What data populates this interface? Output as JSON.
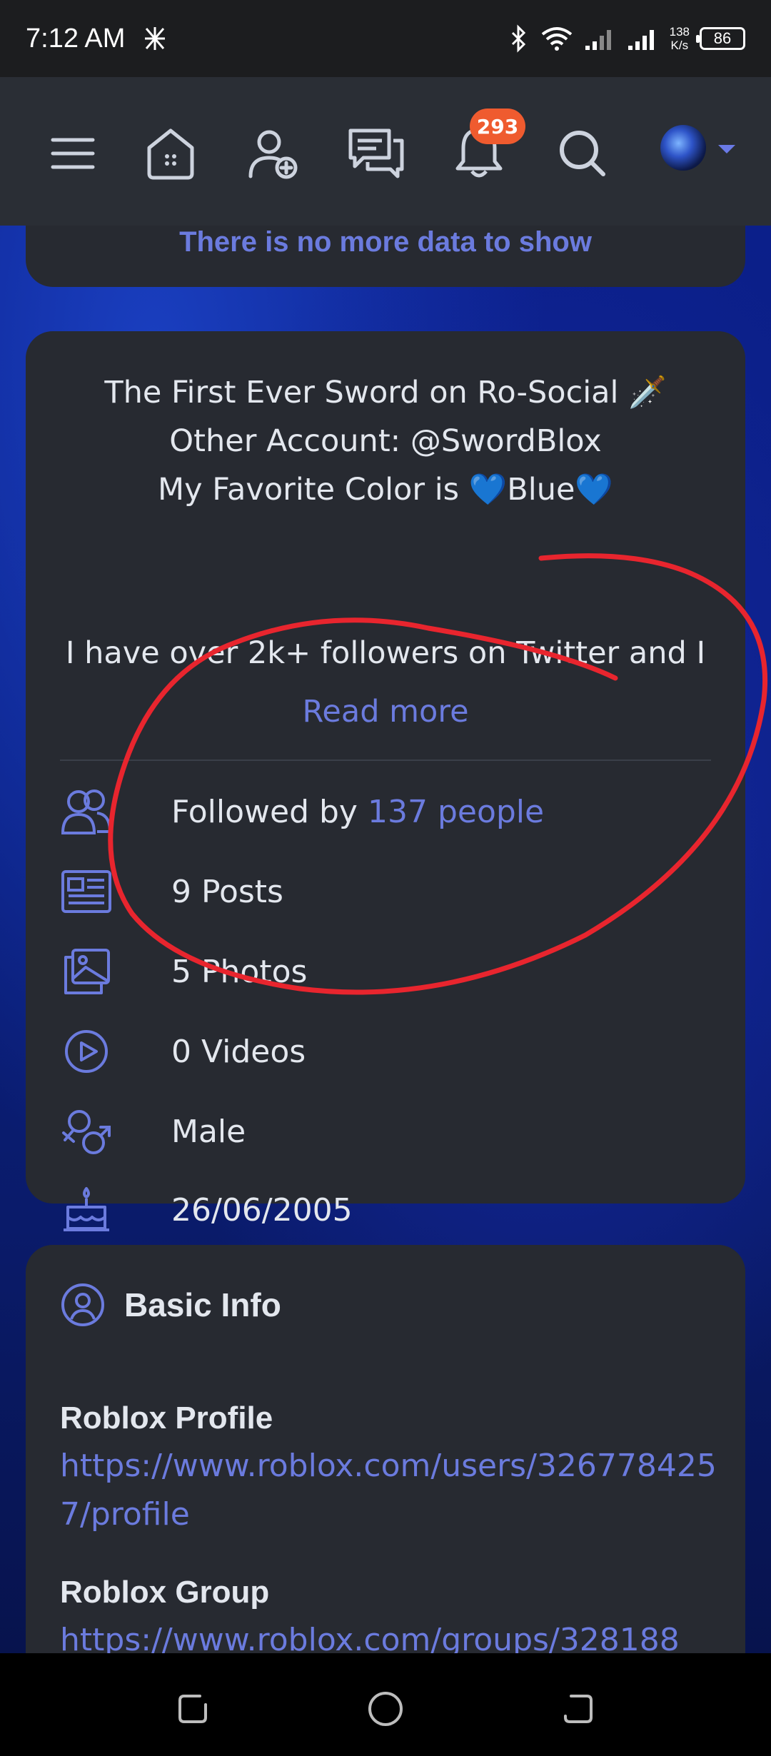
{
  "status_bar": {
    "time": "7:12 AM",
    "speed_value": "138",
    "speed_unit": "K/s",
    "battery": "86"
  },
  "header": {
    "notification_count": "293",
    "icons": [
      "menu-icon",
      "home-icon",
      "add-friend-icon",
      "messages-icon",
      "bell-icon",
      "search-icon",
      "avatar",
      "chevron-down-icon"
    ]
  },
  "feed": {
    "no_more": "There is no more data to show"
  },
  "about": {
    "bio_lines": [
      "The First Ever Sword on Ro-Social 🗡️",
      "Other Account: @SwordBlox",
      "My Favorite Color is 💙Blue💙"
    ],
    "bio_more": "I have over 2k+ followers on Twitter and I",
    "read_more": "Read more",
    "followed_prefix": "Followed by",
    "followed_count": "137 people",
    "posts": "9 Posts",
    "photos": "5 Photos",
    "videos": "0 Videos",
    "gender": "Male",
    "birthday": "26/06/2005"
  },
  "basic_info": {
    "title": "Basic Info",
    "roblox_profile_label": "Roblox Profile",
    "roblox_profile_url": "https://www.roblox.com/users/3267784257/profile",
    "roblox_group_label": "Roblox Group",
    "roblox_group_url": "https://www.roblox.com/groups/328188"
  },
  "colors": {
    "accent": "#6b7bde",
    "card": "#272a31",
    "header": "#2a2e35",
    "badge": "#ef5b2f",
    "annotation": "#e8252e"
  }
}
